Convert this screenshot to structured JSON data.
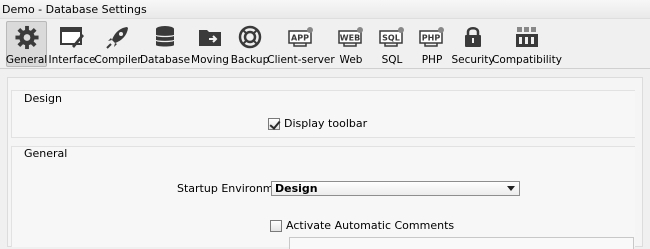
{
  "window": {
    "title": "Demo - Database Settings"
  },
  "toolbar": {
    "items": [
      {
        "label": "General",
        "icon": "gear-icon",
        "selected": true
      },
      {
        "label": "Interface",
        "icon": "interface-window-icon"
      },
      {
        "label": "Compiler",
        "icon": "rocket-icon"
      },
      {
        "label": "Database",
        "icon": "database-icon"
      },
      {
        "label": "Moving",
        "icon": "moving-folder-icon"
      },
      {
        "label": "Backup",
        "icon": "lifebuoy-icon"
      },
      {
        "label": "Client-server",
        "icon": "app-server-icon",
        "badge": "APP"
      },
      {
        "label": "Web",
        "icon": "web-icon",
        "badge": "WEB"
      },
      {
        "label": "SQL",
        "icon": "sql-icon",
        "badge": "SQL"
      },
      {
        "label": "PHP",
        "icon": "php-icon",
        "badge": "PHP"
      },
      {
        "label": "Security",
        "icon": "padlock-icon"
      },
      {
        "label": "Compatibility",
        "icon": "compatibility-icon"
      }
    ]
  },
  "design": {
    "title": "Design",
    "display_toolbar_label": "Display toolbar",
    "display_toolbar_checked": true
  },
  "general": {
    "title": "General",
    "startup_label": "Startup Environment:",
    "startup_value": "Design",
    "auto_comments_label": "Activate Automatic Comments",
    "auto_comments_checked": false
  }
}
